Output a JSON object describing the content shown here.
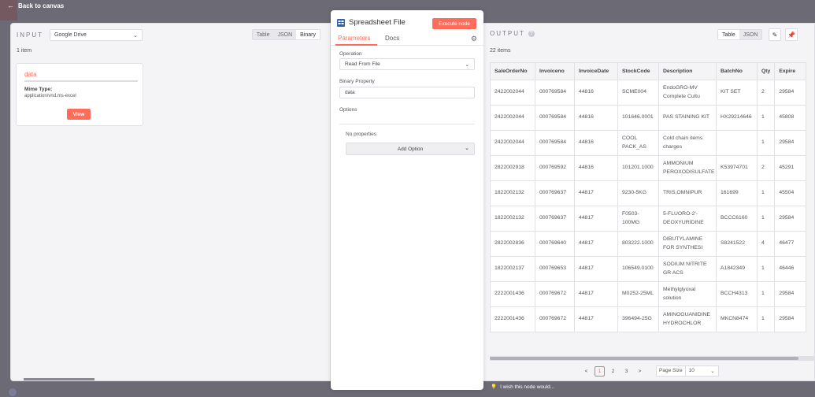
{
  "topbar": {
    "back_label": "Back to canvas"
  },
  "input": {
    "title": "INPUT",
    "node_selected": "Google Drive",
    "views": [
      "Table",
      "JSON",
      "Binary"
    ],
    "active_view": "Binary",
    "item_count": "1 item",
    "binary": {
      "name": "data",
      "mime_label": "Mime Type:",
      "mime_value": "application/vnd.ms-excel",
      "view_label": "View"
    }
  },
  "node": {
    "name": "Spreadsheet File",
    "execute_label": "Execute node",
    "tabs": [
      "Parameters",
      "Docs"
    ],
    "operation_label": "Operation",
    "operation_value": "Read From File",
    "binary_property_label": "Binary Property",
    "binary_property_value": "data",
    "options_label": "Options",
    "no_properties": "No properties",
    "add_option_label": "Add Option"
  },
  "output": {
    "title": "OUTPUT",
    "views": [
      "Table",
      "JSON"
    ],
    "active_view": "Table",
    "item_count": "22 items",
    "columns": [
      "SaleOrderNo",
      "Invoiceno",
      "InvoiceDate",
      "StockCode",
      "Description",
      "BatchNo",
      "Qty",
      "Expire"
    ],
    "rows": [
      [
        "2422002044",
        "000769584",
        "44816",
        "SCME004",
        "EndoGRO-MV Complete Cultu",
        "KIT SET",
        "2",
        "29584"
      ],
      [
        "2422002044",
        "000769584",
        "44816",
        "101646.0001",
        "PAS STAINING KIT",
        "HX29214646",
        "1",
        "45808"
      ],
      [
        "2422002044",
        "000769584",
        "44816",
        "COOL PACK_AS",
        "Cold chain items charges",
        "",
        "1",
        "29584"
      ],
      [
        "2822002918",
        "000769592",
        "44816",
        "101201.1000",
        "AMMONIUM PEROXODISULFATE",
        "K53974701",
        "2",
        "45291"
      ],
      [
        "1822002132",
        "000769637",
        "44817",
        "9230-5KG",
        "TRIS,OMNIPUR",
        "161699",
        "1",
        "45504"
      ],
      [
        "1822002132",
        "000769637",
        "44817",
        "F0503-100MG",
        "5-FLUORO-2'-DEOXYURIDINE",
        "BCCC6160",
        "1",
        "29584"
      ],
      [
        "2822002836",
        "000769640",
        "44817",
        "803222.1000",
        "DIBUTYLAMINE FOR SYNTHESI",
        "S8241522",
        "4",
        "46477"
      ],
      [
        "1822002137",
        "000769653",
        "44817",
        "106549.0100",
        "SODIUM NITRITE GR ACS",
        "A1842349",
        "1",
        "46446"
      ],
      [
        "2222001436",
        "000769672",
        "44817",
        "M0252-25ML",
        "Methylglyoxal solution",
        "BCCH4313",
        "1",
        "29584"
      ],
      [
        "2222001436",
        "000769672",
        "44817",
        "396494-25G",
        "AMINOGUANIDINE HYDROCHLOR",
        "MKCN8474",
        "1",
        "29584"
      ]
    ],
    "pager": {
      "prev": "<",
      "pages": [
        "1",
        "2",
        "3"
      ],
      "current": "1",
      "next": ">",
      "page_size_label": "Page Size",
      "page_size_value": "10"
    }
  },
  "feedback": "I wish this node would..."
}
